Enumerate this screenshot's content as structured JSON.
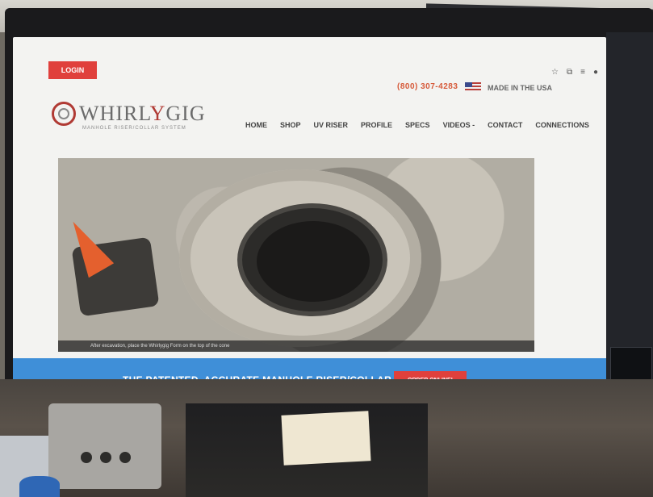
{
  "site": {
    "login_label": "LOGIN",
    "phone": "(800) 307-4283",
    "made_in_usa": "MADE IN THE USA",
    "logo_text_prefix": "WHIRL",
    "logo_text_y": "Y",
    "logo_text_suffix": "GIG",
    "logo_tagline": "MANHOLE RISER/COLLAR SYSTEM",
    "nav": [
      {
        "label": "HOME"
      },
      {
        "label": "SHOP"
      },
      {
        "label": "UV RISER"
      },
      {
        "label": "PROFILE"
      },
      {
        "label": "SPECS"
      },
      {
        "label": "VIDEOS -"
      },
      {
        "label": "CONTACT"
      },
      {
        "label": "CONNECTIONS"
      }
    ],
    "hero_caption": "After excavation, place the Whirlygig Form on the top of the cone",
    "banner_text": "THE PATENTED, ACCURATE MANHOLE RISER/COLLAR SYSTEM",
    "order_label": "ORDER ONLINE!"
  },
  "colors": {
    "accent_red": "#e0403c",
    "banner_blue": "#3f8fd8",
    "phone_orange": "#d65a3a"
  },
  "icons": {
    "browser": [
      "star-icon",
      "extensions-icon",
      "menu-icon",
      "profile-icon"
    ],
    "taskbar": [
      "app-icon",
      "tools-icon",
      "folder-icon",
      "video-icon",
      "trash-icon",
      "record-icon"
    ]
  }
}
